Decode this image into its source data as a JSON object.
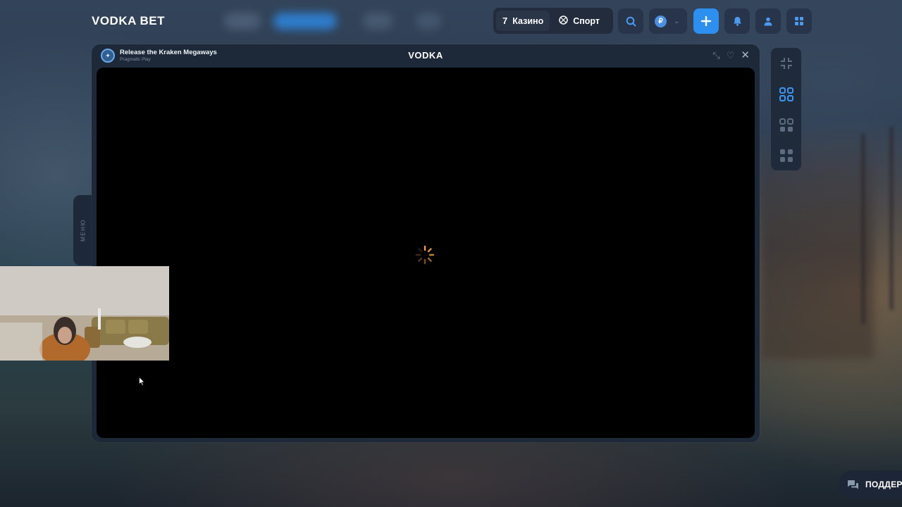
{
  "header": {
    "logo_text": "VODKA BET",
    "nav": [
      {
        "label": "Казино",
        "icon": "seven-icon",
        "active": true
      },
      {
        "label": "Спорт",
        "icon": "ball-icon",
        "active": false
      }
    ],
    "buttons": [
      "search-icon",
      "wallet-coin-icon",
      "plus-icon",
      "bell-icon",
      "user-icon",
      "grid-icon"
    ],
    "wallet_coin_symbol": "₽",
    "accent_color": "#2d8ff0"
  },
  "game_window": {
    "title": "Release the Kraken Megaways",
    "provider": "Pragmatic Play",
    "logo": "VODKA",
    "actions": [
      "shrink-icon",
      "heart-icon",
      "close-icon"
    ]
  },
  "side_menu": {
    "label": "МЕНЮ"
  },
  "layout_panel": {
    "options": [
      "minimize-icon",
      "layout-1-icon",
      "layout-2-icon",
      "layout-4-icon"
    ]
  },
  "support": {
    "label": "ПОДДЕР"
  }
}
